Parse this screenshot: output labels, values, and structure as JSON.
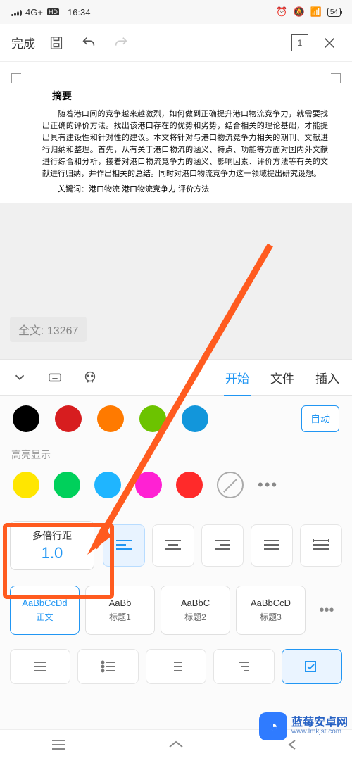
{
  "status": {
    "net": "4G+",
    "time": "16:34",
    "battery": "54"
  },
  "toolbar": {
    "done": "完成",
    "page": "1"
  },
  "doc": {
    "title": "摘要",
    "p1": "随着港口间的竞争越来越激烈，如何做到正确提升港口物流竞争力，就需要找出正确的评价方法。找出该港口存在的优势和劣势，结合相关的理论基础，才能提出具有建设性和针对性的建议。本文将针对与港口物流竞争力相关的期刊、文献进行归纳和整理。首先，从有关于港口物流的涵义、特点、功能等方面对国内外文献进行综合和分析，接着对港口物流竞争力的涵义、影响因素、评价方法等有关的文献进行归纳，并作出相关的总结。同时对港口物流竞争力这一领域提出研究设想。",
    "kw": "关键词：港口物流  港口物流竞争力  评价方法"
  },
  "count": {
    "label": "全文: 13267"
  },
  "tabs": {
    "start": "开始",
    "file": "文件",
    "insert": "插入"
  },
  "colors_top": [
    "#000000",
    "#d71d1f",
    "#ff7a00",
    "#6cc300",
    "#1296db"
  ],
  "auto": "自动",
  "highlight_label": "高亮显示",
  "colors_hl": [
    "#ffe600",
    "#00d05b",
    "#1fb5ff",
    "#ff21d3",
    "#ff2a2a"
  ],
  "line_spacing": {
    "label": "多倍行距",
    "value": "1.0"
  },
  "styles": [
    {
      "sample": "AaBbCcDd",
      "name": "正文",
      "selected": true
    },
    {
      "sample": "AaBb",
      "name": "标题1"
    },
    {
      "sample": "AaBbC",
      "name": "标题2"
    },
    {
      "sample": "AaBbCcD",
      "name": "标题3"
    }
  ],
  "watermark": {
    "name": "蓝莓安卓网",
    "url": "www.lmkjst.com"
  }
}
